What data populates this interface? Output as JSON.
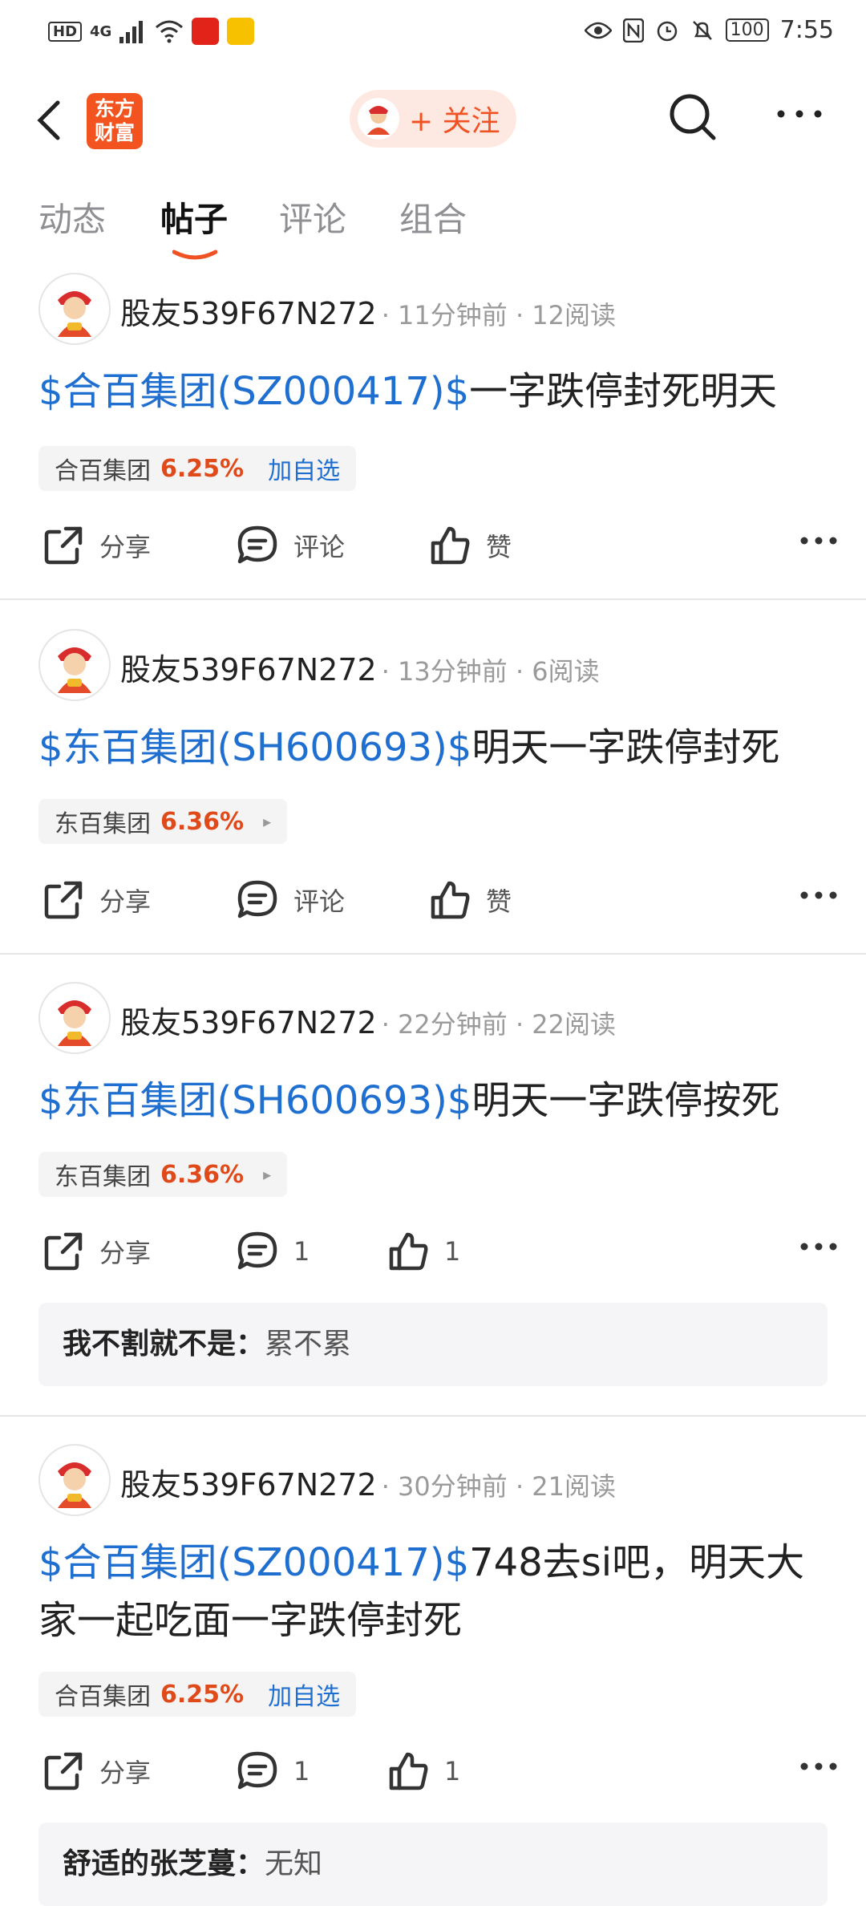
{
  "status_bar": {
    "network_badge": "HD",
    "signal": "4G",
    "battery": "100",
    "time": "7:55"
  },
  "header": {
    "logo_line1": "东方",
    "logo_line2": "财富",
    "follow_label": "+ 关注"
  },
  "tabs": [
    {
      "label": "动态"
    },
    {
      "label": "帖子"
    },
    {
      "label": "评论"
    },
    {
      "label": "组合"
    }
  ],
  "active_tab": "帖子",
  "posts": [
    {
      "user": "股友539F67N272",
      "info": "· 11分钟前 · 12阅读",
      "tag": "$合百集团(SZ000417)$",
      "text": "一字跌停封死明天",
      "stock_name": "合百集团",
      "stock_pct": "6.25%",
      "stock_action": "加自选",
      "share": "分享",
      "comment": "评论",
      "like": "赞"
    },
    {
      "user": "股友539F67N272",
      "info": "· 13分钟前 · 6阅读",
      "tag": "$东百集团(SH600693)$",
      "text": "明天一字跌停封死",
      "stock_name": "东百集团",
      "stock_pct": "6.36%",
      "stock_action": "▸",
      "share": "分享",
      "comment": "评论",
      "like": "赞"
    },
    {
      "user": "股友539F67N272",
      "info": "· 22分钟前 · 22阅读",
      "tag": "$东百集团(SH600693)$",
      "text": "明天一字跌停按死",
      "stock_name": "东百集团",
      "stock_pct": "6.36%",
      "stock_action": "▸",
      "share": "分享",
      "comment": "1",
      "like": "1",
      "reply_user": "我不割就不是：",
      "reply_text": "累不累"
    },
    {
      "user": "股友539F67N272",
      "info": "· 30分钟前 · 21阅读",
      "tag": "$合百集团(SZ000417)$",
      "text": "748去si吧，明天大家一起吃面一字跌停封死",
      "stock_name": "合百集团",
      "stock_pct": "6.25%",
      "stock_action": "加自选",
      "share": "分享",
      "comment": "1",
      "like": "1",
      "reply_user": "舒适的张芝蔓：",
      "reply_text": "无知"
    }
  ],
  "colors": {
    "accent": "#f05223",
    "link": "#1f6fd1",
    "percent": "#e04a1a"
  }
}
